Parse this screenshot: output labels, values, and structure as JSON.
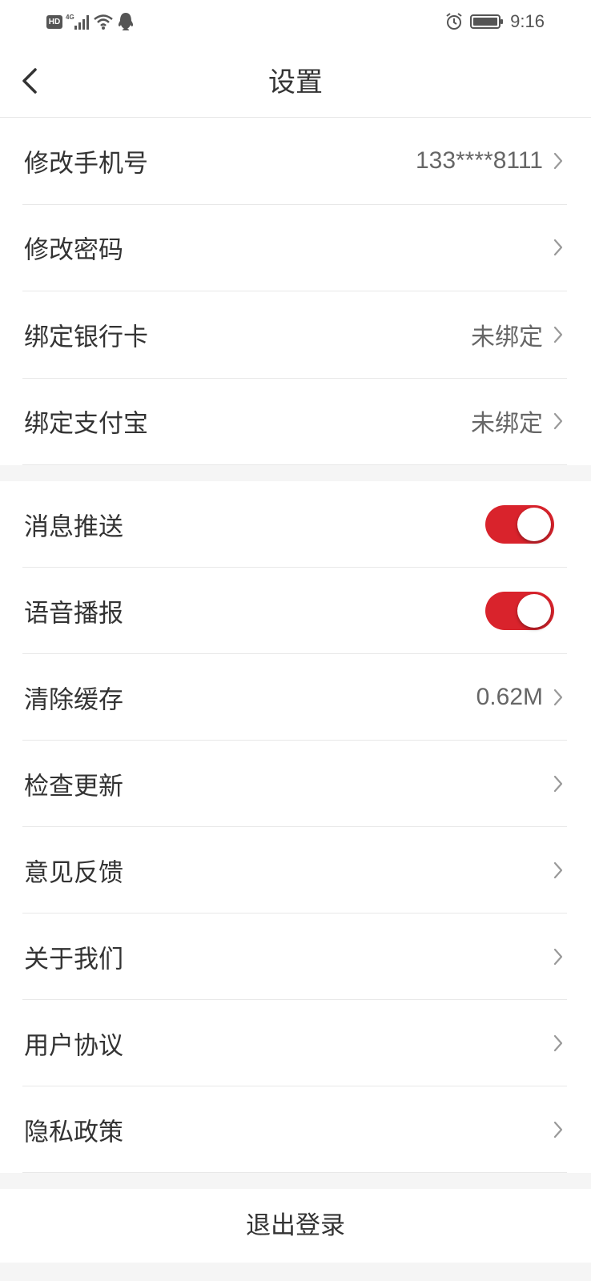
{
  "status_bar": {
    "hd_label": "HD",
    "network_label": "4G",
    "time": "9:16",
    "icons": [
      "hd-icon",
      "signal-icon",
      "wifi-icon",
      "qq-icon",
      "alarm-icon",
      "battery-icon"
    ]
  },
  "nav": {
    "title": "设置",
    "back_icon": "chevron-left-icon"
  },
  "account_group": [
    {
      "label": "修改手机号",
      "value": "133****8111"
    },
    {
      "label": "修改密码",
      "value": ""
    },
    {
      "label": "绑定银行卡",
      "value": "未绑定"
    },
    {
      "label": "绑定支付宝",
      "value": "未绑定"
    }
  ],
  "settings_group": [
    {
      "label": "消息推送",
      "type": "toggle",
      "on": true
    },
    {
      "label": "语音播报",
      "type": "toggle",
      "on": true
    },
    {
      "label": "清除缓存",
      "value": "0.62M"
    },
    {
      "label": "检查更新",
      "value": ""
    },
    {
      "label": "意见反馈",
      "value": ""
    },
    {
      "label": "关于我们",
      "value": ""
    },
    {
      "label": "用户协议",
      "value": ""
    },
    {
      "label": "隐私政策",
      "value": ""
    }
  ],
  "logout_label": "退出登录",
  "colors": {
    "accent": "#d9232c",
    "background": "#f5f5f5",
    "text": "#333333",
    "secondary_text": "#666666"
  }
}
